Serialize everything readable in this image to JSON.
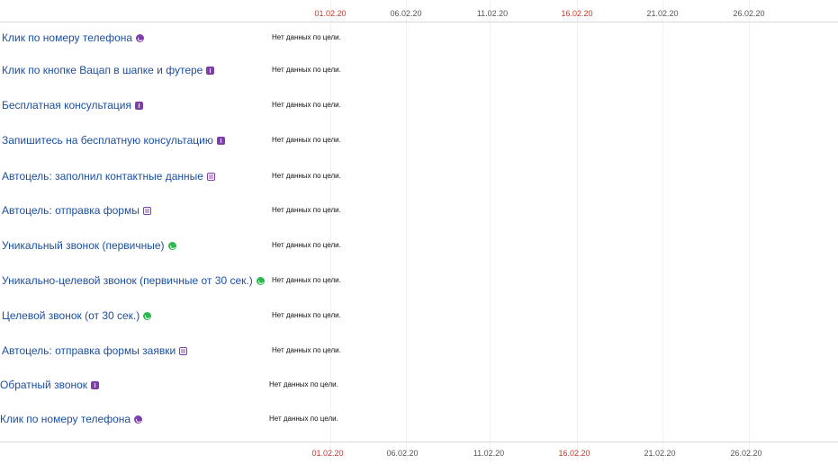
{
  "axis_top": {
    "ticks": [
      {
        "label": "01.02.20",
        "highlight": true
      },
      {
        "label": "06.02.20",
        "highlight": false
      },
      {
        "label": "11.02.20",
        "highlight": false
      },
      {
        "label": "16.02.20",
        "highlight": true
      },
      {
        "label": "21.02.20",
        "highlight": false
      },
      {
        "label": "26.02.20",
        "highlight": false
      }
    ]
  },
  "axis_bottom": {
    "ticks": [
      {
        "label": "01.02.20",
        "highlight": true
      },
      {
        "label": "06.02.20",
        "highlight": false
      },
      {
        "label": "11.02.20",
        "highlight": false
      },
      {
        "label": "16.02.20",
        "highlight": true
      },
      {
        "label": "21.02.20",
        "highlight": false
      },
      {
        "label": "26.02.20",
        "highlight": false
      }
    ]
  },
  "goals": [
    {
      "label": "Клик по номеру телефона",
      "icon": "phone-call-icon",
      "status": "Нет данных по цели."
    },
    {
      "label": "Клик по кнопке Вацап в шапке и футере",
      "icon": "exclamation-icon",
      "status": "Нет данных по цели."
    },
    {
      "label": "Бесплатная консультация",
      "icon": "exclamation-icon",
      "status": "Нет данных по цели."
    },
    {
      "label": "Запишитесь на бесплатную консультацию",
      "icon": "exclamation-icon",
      "status": "Нет данных по цели."
    },
    {
      "label": "Автоцель: заполнил контактные данные",
      "icon": "contact-form-icon",
      "status": "Нет данных по цели."
    },
    {
      "label": "Автоцель: отправка формы",
      "icon": "form-icon",
      "status": "Нет данных по цели."
    },
    {
      "label": "Уникальный звонок (первичные)",
      "icon": "phone-call-green-icon",
      "status": "Нет данных по цели."
    },
    {
      "label": "Уникально-целевой звонок (первичные от 30 сек.)",
      "icon": "phone-call-green-icon",
      "status": "Нет данных по цели."
    },
    {
      "label": "Целевой звонок (от 30 сек.)",
      "icon": "phone-call-green-icon",
      "status": "Нет данных по цели."
    },
    {
      "label": "Автоцель: отправка формы заявки",
      "icon": "form-icon",
      "status": "Нет данных по цели."
    },
    {
      "label": "Обратный звонок",
      "icon": "exclamation-icon",
      "status": "Нет данных по цели."
    },
    {
      "label": "Клик по номеру телефона",
      "icon": "phone-call-icon",
      "status": "Нет данных по цели."
    }
  ],
  "colors": {
    "link": "#1c4fa0",
    "icon_purple": "#7e3fa9",
    "icon_green": "#2fb74f",
    "date_highlight": "#c0392b"
  }
}
